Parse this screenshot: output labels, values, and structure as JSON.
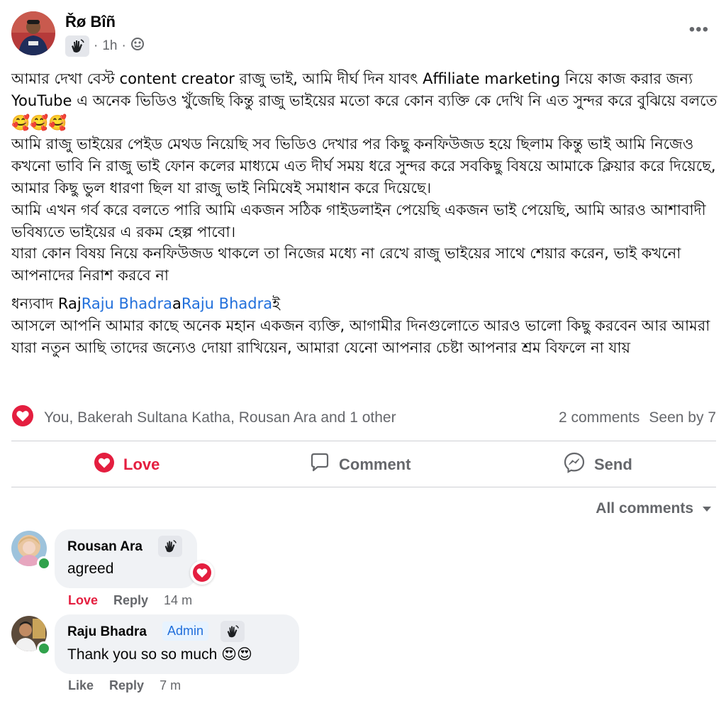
{
  "post": {
    "author": "Řø Bîñ",
    "time": "1h",
    "separator": "·",
    "icons": {
      "badge": "wave-hand-icon",
      "audience": "globe-icon",
      "more": "more-options-icon"
    },
    "more_label": "•••",
    "body": {
      "p1": "আমার দেখা বেস্ট content creator রাজু ভাই, আমি দীর্ঘ দিন যাবৎ Affiliate marketing নিয়ে কাজ করার জন্য YouTube এ অনেক ভিডিও খুঁজেছি কিন্তু রাজু ভাইয়ের মতো করে কোন ব্যক্তি কে দেখি নি এত সুন্দর করে বুঝিয়ে বলতে",
      "p1_emoji": "🥰🥰🥰",
      "p2": "আমি রাজু ভাইয়ের পেইড মেথড নিয়েছি সব ভিডিও দেখার পর কিছু কনফিউজড হয়ে ছিলাম কিন্তু ভাই আমি নিজেও কখনো ভাবি নি রাজু ভাই ফোন কলের মাধ্যমে এত দীর্ঘ সময় ধরে সুন্দর করে সবকিছু বিষয়ে আমাকে ক্লিয়ার করে দিয়েছে, আমার কিছু ভুল ধারণা ছিল যা রাজু ভাই নিমিষেই সমাধান করে দিয়েছে।",
      "p3": "আমি এখন গর্ব করে বলতে পারি আমি একজন সঠিক গাইডলাইন পেয়েছি একজন ভাই পেয়েছি, আমি আরও আশাবাদী ভবিষ্যতে ভাইয়ের এ রকম হেল্প পাবো।",
      "p4": "যারা কোন বিষয় নিয়ে কনফিউজড থাকলে তা নিজের মধ্যে না রেখে রাজু ভাইয়ের সাথে শেয়ার করেন, ভাই কখনো আপনাদের নিরাশ করবে না",
      "thanks_prefix": "ধন্যবাদ Raj",
      "mention1": "Raju Bhadra",
      "thanks_mid": "a",
      "mention2": "Raju Bhadra",
      "thanks_suffix": "ই",
      "p5": "আসলে আপনি আমার কাছে অনেক মহান একজন ব্যক্তি, আগামীর দিনগুলোতে আরও ভালো কিছু করবেন আর আমরা যারা নতুন আছি তাদের জন্যেও দোয়া রাখিয়েন, আমারা যেনো আপনার চেষ্টা আপনার শ্রম বিফলে না যায়"
    }
  },
  "reactions": {
    "icon": "love-reaction-icon",
    "names": "You, Bakerah Sultana Katha, Rousan Ara and 1 other",
    "comments": "2 comments",
    "seen": "Seen by 7"
  },
  "actions": [
    {
      "label": "Love",
      "icon": "love-icon",
      "color": "#e41e3f"
    },
    {
      "label": "Comment",
      "icon": "comment-icon"
    },
    {
      "label": "Send",
      "icon": "messenger-icon"
    }
  ],
  "comments_filter": {
    "label": "All comments",
    "icon": "caret-down-icon"
  },
  "comments": [
    {
      "author": "Rousan Ara",
      "badge_icon": "wave-hand-icon",
      "text": "agreed",
      "reaction_icon": "love-reaction-icon",
      "actions": [
        "Love",
        "Reply"
      ],
      "time": "14 m",
      "love_color": "#e41e3f"
    },
    {
      "author": "Raju Bhadra",
      "role": "Admin",
      "badge_icon": "wave-hand-icon",
      "text": "Thank you so so much",
      "text_emoji": "😍😍",
      "actions": [
        "Like",
        "Reply"
      ],
      "time": "7 m"
    }
  ],
  "colors": {
    "love": "#e41e3f",
    "link": "#216fdb",
    "secondary": "#65676b",
    "bubble": "#f0f2f5",
    "online": "#31a24c"
  }
}
